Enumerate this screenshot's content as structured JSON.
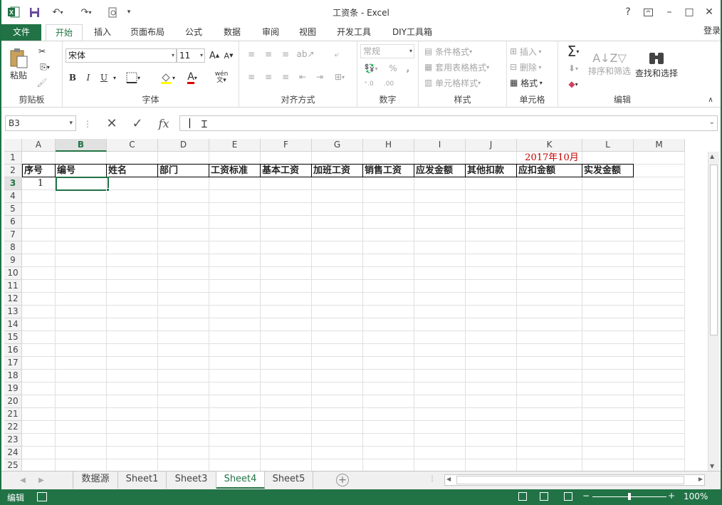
{
  "window": {
    "title": "工资条 - Excel"
  },
  "title_icons": {
    "excel": "excel-logo-icon",
    "save": "save-icon",
    "undo": "undo-icon",
    "redo": "redo-icon",
    "preview": "print-preview-icon",
    "customize": "customize-qat-icon"
  },
  "window_buttons": {
    "help": "?",
    "restore_ribbon": "ribbon-display-icon",
    "minimize": "–",
    "maximize": "□",
    "close": "✕"
  },
  "tabs": [
    {
      "label": "文件"
    },
    {
      "label": "开始"
    },
    {
      "label": "插入"
    },
    {
      "label": "页面布局"
    },
    {
      "label": "公式"
    },
    {
      "label": "数据"
    },
    {
      "label": "审阅"
    },
    {
      "label": "视图"
    },
    {
      "label": "开发工具"
    },
    {
      "label": "DIY工具箱"
    }
  ],
  "login": "登录",
  "ribbon": {
    "clipboard": {
      "label": "剪贴板",
      "paste": "粘贴"
    },
    "font": {
      "label": "字体",
      "font_name": "宋体",
      "font_size": "11",
      "bold": "B",
      "italic": "I",
      "underline": "U",
      "font_color": "A",
      "wen": "wén"
    },
    "alignment": {
      "label": "对齐方式"
    },
    "number": {
      "label": "数字",
      "format": "常规",
      "percent": "%"
    },
    "styles": {
      "label": "样式",
      "cond": "条件格式",
      "table": "套用表格格式",
      "cell": "单元格样式"
    },
    "cells": {
      "label": "单元格",
      "insert": "插入",
      "delete": "删除",
      "format": "格式"
    },
    "editing": {
      "label": "编辑",
      "sort": "排序和筛选",
      "find": "查找和选择",
      "sigma": "Σ"
    }
  },
  "formula_bar": {
    "name_box": "B3",
    "cancel": "✕",
    "enter": "✓",
    "fx": "fx",
    "value": ""
  },
  "columns": [
    "A",
    "B",
    "C",
    "D",
    "E",
    "F",
    "G",
    "H",
    "I",
    "J",
    "K",
    "L",
    "M"
  ],
  "rows": [
    "1",
    "2",
    "3",
    "4",
    "5",
    "6",
    "7",
    "8",
    "9",
    "10",
    "11",
    "12",
    "13",
    "14",
    "15",
    "16",
    "17",
    "18",
    "19",
    "20",
    "21",
    "22",
    "23",
    "24",
    "25"
  ],
  "sheet": {
    "date_label": "2017年10月",
    "headers": [
      "序号",
      "编号",
      "姓名",
      "部门",
      "工资标准",
      "基本工资",
      "加班工资",
      "销售工资",
      "应发金额",
      "其他扣款",
      "应扣金额",
      "实发金额"
    ],
    "row3_a": "1"
  },
  "sheet_tabs": [
    "数据源",
    "Sheet1",
    "Sheet3",
    "Sheet4",
    "Sheet5"
  ],
  "active_sheet": "Sheet4",
  "status": {
    "mode": "编辑",
    "zoom": "100%"
  },
  "colors": {
    "accent": "#217346",
    "date_red": "#c00000"
  }
}
